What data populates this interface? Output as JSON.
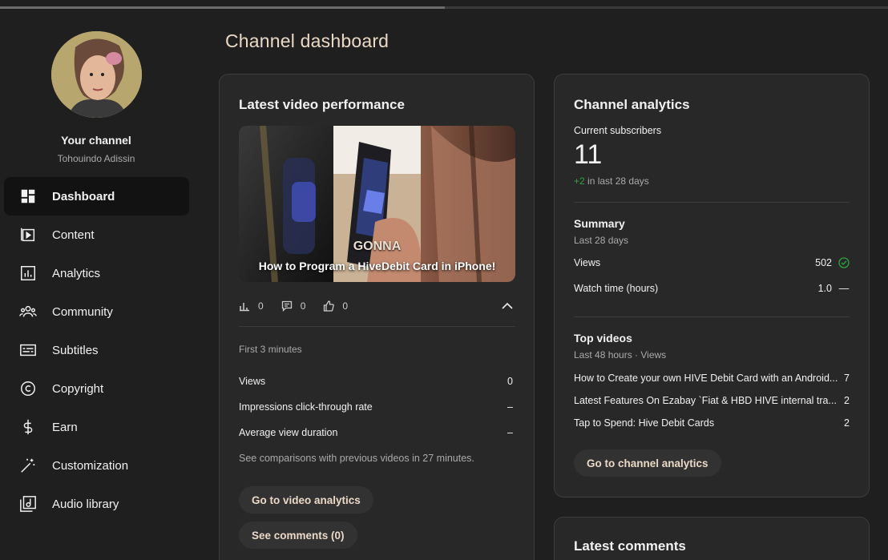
{
  "sidebar": {
    "channel_title": "Your channel",
    "channel_name": "Tohouindo Adissin",
    "items": [
      {
        "label": "Dashboard",
        "icon": "dashboard-icon",
        "active": true
      },
      {
        "label": "Content",
        "icon": "content-icon"
      },
      {
        "label": "Analytics",
        "icon": "analytics-icon"
      },
      {
        "label": "Community",
        "icon": "community-icon"
      },
      {
        "label": "Subtitles",
        "icon": "subtitles-icon"
      },
      {
        "label": "Copyright",
        "icon": "copyright-icon"
      },
      {
        "label": "Earn",
        "icon": "dollar-icon"
      },
      {
        "label": "Customization",
        "icon": "magic-wand-icon"
      },
      {
        "label": "Audio library",
        "icon": "audio-library-icon"
      }
    ]
  },
  "main": {
    "page_title": "Channel dashboard"
  },
  "latest_video": {
    "heading": "Latest video performance",
    "thumbnail_title": "How to Program a HiveDebit Card in iPhone!",
    "thumbnail_overlay": "GONNA",
    "stats": {
      "views": "0",
      "comments": "0",
      "likes": "0"
    },
    "period": "First 3 minutes",
    "metrics": [
      {
        "label": "Views",
        "value": "0"
      },
      {
        "label": "Impressions click-through rate",
        "value": "–"
      },
      {
        "label": "Average view duration",
        "value": "–"
      }
    ],
    "comparison_note": "See comparisons with previous videos in 27 minutes.",
    "analytics_button": "Go to video analytics",
    "comments_button": "See comments (0)"
  },
  "channel_analytics": {
    "heading": "Channel analytics",
    "subscribers_label": "Current subscribers",
    "subscribers_count": "11",
    "subscribers_change": "+2",
    "subscribers_change_period": "in last 28 days",
    "summary_heading": "Summary",
    "summary_period": "Last 28 days",
    "summary_rows": [
      {
        "label": "Views",
        "value": "502",
        "status": "check"
      },
      {
        "label": "Watch time (hours)",
        "value": "1.0",
        "status": "—"
      }
    ],
    "top_videos_heading": "Top videos",
    "top_videos_period": "Last 48 hours · Views",
    "top_videos": [
      {
        "title": "How to Create your own HIVE Debit Card with an Android...",
        "views": "7"
      },
      {
        "title": "Latest Features On Ezabay `Fiat & HBD HIVE internal tra...",
        "views": "2"
      },
      {
        "title": "Tap to Spend: Hive Debit Cards",
        "views": "2"
      }
    ],
    "button": "Go to channel analytics"
  },
  "latest_comments": {
    "heading": "Latest comments"
  },
  "colors": {
    "background": "#1f1f1f",
    "card": "#282828",
    "accent_text": "#ead9c6",
    "positive": "#2ba640"
  }
}
